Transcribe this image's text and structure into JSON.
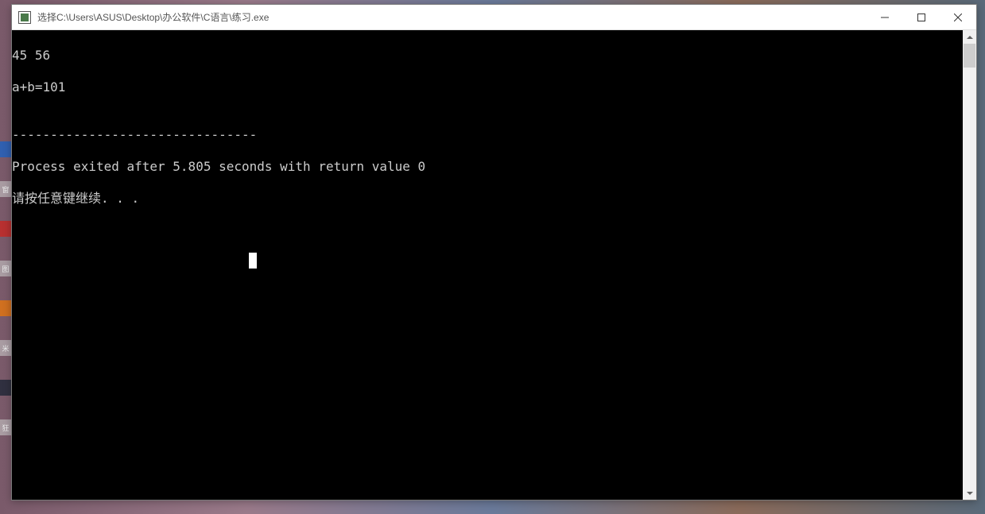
{
  "window": {
    "title": "选择C:\\Users\\ASUS\\Desktop\\办公软件\\C语言\\练习.exe"
  },
  "console": {
    "line1": "45 56",
    "line2": "a+b=101",
    "line3": "",
    "line4": "--------------------------------",
    "line5": "Process exited after 5.805 seconds with return value 0",
    "line6": "请按任意键继续. . ."
  },
  "desktop_fragments": {
    "f1": "窗",
    "f2": "",
    "f3": "图",
    "f4": "",
    "f5": "米",
    "f6": "",
    "f7": "狂"
  }
}
